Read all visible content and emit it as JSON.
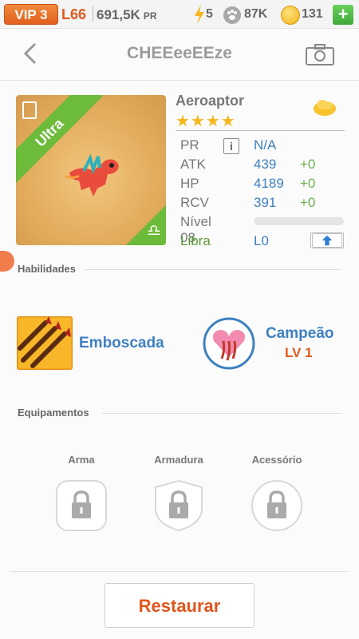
{
  "status_bar": {
    "vip": "VIP 3",
    "level": "L66",
    "power": "691,5K",
    "power_unit": "PR",
    "energy": "5",
    "food": "87K",
    "gold": "131",
    "add_label": "+"
  },
  "header": {
    "title": "CHEEeeEEze"
  },
  "dragon": {
    "rarity": "Ultra",
    "name": "Aeroaptor",
    "stars": "★★★★",
    "stats": [
      {
        "label": "PR",
        "value": "N/A",
        "bonus": ""
      },
      {
        "label": "ATK",
        "value": "439",
        "bonus": "+0"
      },
      {
        "label": "HP",
        "value": "4189",
        "bonus": "+0"
      },
      {
        "label": "RCV",
        "value": "391",
        "bonus": "+0"
      }
    ],
    "info_label": "i",
    "level_label": "Nível 08",
    "level_progress": 0,
    "sign_label": "Libra",
    "sign_level": "L0"
  },
  "skills": {
    "section_title": "Habilidades",
    "items": [
      {
        "name": "Emboscada",
        "level": ""
      },
      {
        "name": "Campeão",
        "level": "LV 1"
      }
    ]
  },
  "equipment": {
    "section_title": "Equipamentos",
    "slots": [
      {
        "label": "Arma"
      },
      {
        "label": "Armadura"
      },
      {
        "label": "Acessório"
      }
    ]
  },
  "footer": {
    "restore_label": "Restaurar"
  }
}
